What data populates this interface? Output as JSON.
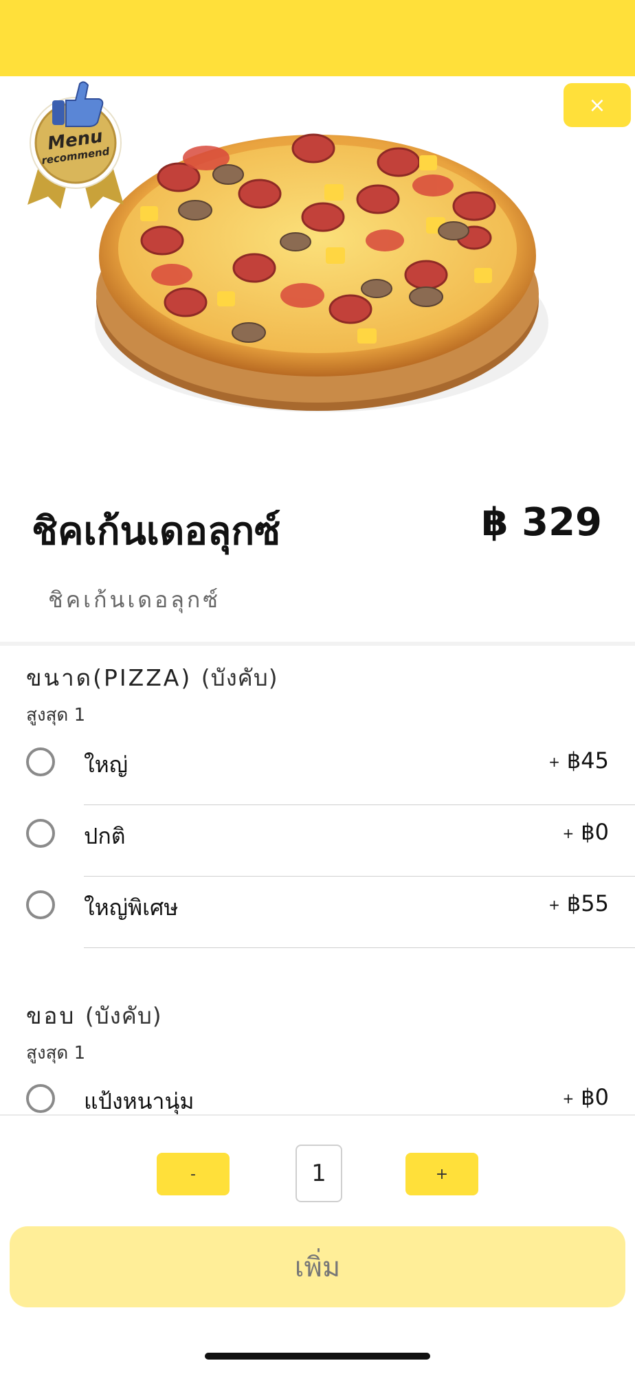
{
  "header": {
    "close_icon": "×"
  },
  "hero": {
    "badge_line1": "Menu",
    "badge_line2": "recommend"
  },
  "product": {
    "name": "ชิคเก้นเดอลุกซ์",
    "price": "฿ 329",
    "description": "ชิคเก้นเดอลุกซ์"
  },
  "groups": [
    {
      "title": "ขนาด(PIZZA)",
      "required": "(บังคับ)",
      "max": "สูงสุด 1",
      "options": [
        {
          "label": "ใหญ่",
          "plus": "+",
          "price": "฿45"
        },
        {
          "label": "ปกติ",
          "plus": "+",
          "price": "฿0"
        },
        {
          "label": "ใหญ่พิเศษ",
          "plus": "+",
          "price": "฿55"
        }
      ]
    },
    {
      "title": "ขอบ",
      "required": "(บังคับ)",
      "max": "สูงสุด 1",
      "options": [
        {
          "label": "แป้งหนานุ่ม",
          "plus": "+",
          "price": "฿0"
        }
      ]
    }
  ],
  "footer": {
    "minus_label": "-",
    "quantity": "1",
    "plus_label": "+",
    "add_label": "เพิ่ม"
  },
  "colors": {
    "accent": "#FFE03A",
    "add_button": "#FFEE98"
  }
}
